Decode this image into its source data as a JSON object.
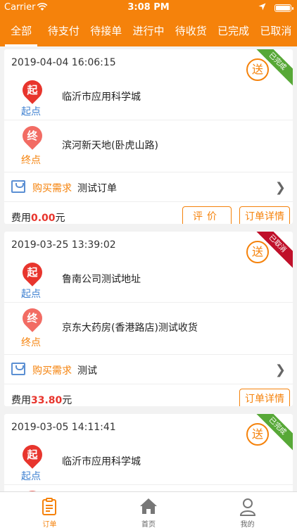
{
  "status": {
    "carrier": "Carrier",
    "time": "3:08 PM"
  },
  "tabs": [
    {
      "label": "全部"
    },
    {
      "label": "待支付"
    },
    {
      "label": "待接单"
    },
    {
      "label": "进行中"
    },
    {
      "label": "待收货"
    },
    {
      "label": "已完成"
    },
    {
      "label": "已取消"
    }
  ],
  "common": {
    "start_icon": "起",
    "start_label": "起点",
    "end_icon": "终",
    "end_label": "终点",
    "req_label": "购买需求",
    "fee_prefix": "费用",
    "fee_suffix": "元",
    "send_badge": "送",
    "review_button": "评价",
    "detail_button": "订单详情"
  },
  "orders": [
    {
      "date": "2019-04-04 16:06:15",
      "status": "已完成",
      "start": "临沂市应用科学城",
      "end": "滨河新天地(卧虎山路)",
      "requirement": "测试订单",
      "fee": "0.00"
    },
    {
      "date": "2019-03-25 13:39:02",
      "status": "已取消",
      "start": "鲁南公司测试地址",
      "end": "京东大药房(香港路店)测试收货",
      "requirement": "测试",
      "fee": "33.80"
    },
    {
      "date": "2019-03-05 14:11:41",
      "status": "已完成",
      "start": "临沂市应用科学城"
    }
  ],
  "tabbar": [
    {
      "label": "订单",
      "icon": "order-icon"
    },
    {
      "label": "首页",
      "icon": "home-icon"
    },
    {
      "label": "我的",
      "icon": "profile-icon"
    }
  ],
  "colors": {
    "brand": "#f5820b",
    "done": "#57a837",
    "cancel": "#c0102a",
    "price": "#e8352d",
    "start_label": "#3c7fd0"
  }
}
